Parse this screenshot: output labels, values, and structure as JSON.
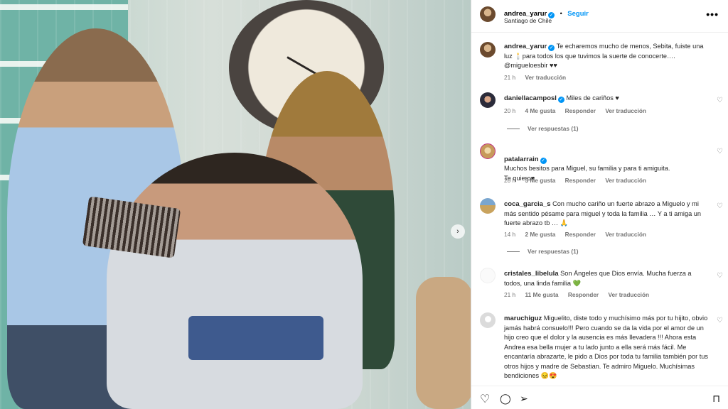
{
  "post": {
    "author": "andrea_yarur",
    "follow_label": "Seguir",
    "location": "Santiago de Chile",
    "more_label": "•••"
  },
  "caption": {
    "author": "andrea_yarur",
    "text": "Te echaremos mucho de menos, Sebita, fuiste una luz 🕯️para todos los que tuvimos la suerte de conocerte…. @migueloesbir ♥♥",
    "time": "21 h",
    "translate": "Ver traducción"
  },
  "comments": [
    {
      "author": "daniellacamposl",
      "verified": true,
      "text": "Miles de cariños ♥",
      "time": "20 h",
      "likes": "4 Me gusta",
      "reply": "Responder",
      "translate": "Ver traducción",
      "replies": "Ver respuestas (1)"
    },
    {
      "author": "patalarrain",
      "verified": true,
      "text": "Muchos besitos para Miguel, su familia y para ti amiguita.\nTe quiero♥",
      "time": "20 h",
      "likes": "5 Me gusta",
      "reply": "Responder",
      "translate": "Ver traducción"
    },
    {
      "author": "coca_garcia_s",
      "verified": false,
      "text": "Con mucho cariño un fuerte abrazo a Miguelo y mi más sentido pésame para miguel y toda la familia … Y a ti amiga un fuerte abrazo tb … 🙏",
      "time": "14 h",
      "likes": "2 Me gusta",
      "reply": "Responder",
      "translate": "Ver traducción",
      "replies": "Ver respuestas (1)"
    },
    {
      "author": "cristales_libelula",
      "verified": false,
      "text": "Son Ángeles que Dios envía. Mucha fuerza a todos, una linda familia 💚",
      "time": "21 h",
      "likes": "11 Me gusta",
      "reply": "Responder",
      "translate": "Ver traducción"
    },
    {
      "author": "maruchiguz",
      "verified": false,
      "text": "Miguelito, diste todo y muchísimo más por tu hijito, obvio jamás habrá consuelo!!! Pero cuando se da la vida por el amor de un hijo creo que el dolor y la ausencia es más llevadera !!! Ahora esta Andrea esa bella mujer a tu lado junto a ella será más fácil. Me encantaría abrazarte, le pido a Dios por toda tu familia también por tus otros hijos y madre de Sebastian. Te admiro Miguelo. Muchísimas bendiciones 😣😍"
    }
  ],
  "icons": {
    "verified": "✓",
    "heart_small": "♡",
    "next": "›",
    "like": "♡",
    "comment": "◯",
    "share": "➢",
    "save": "⊓"
  },
  "colors": {
    "accent": "#0095f6",
    "muted": "#737373"
  }
}
